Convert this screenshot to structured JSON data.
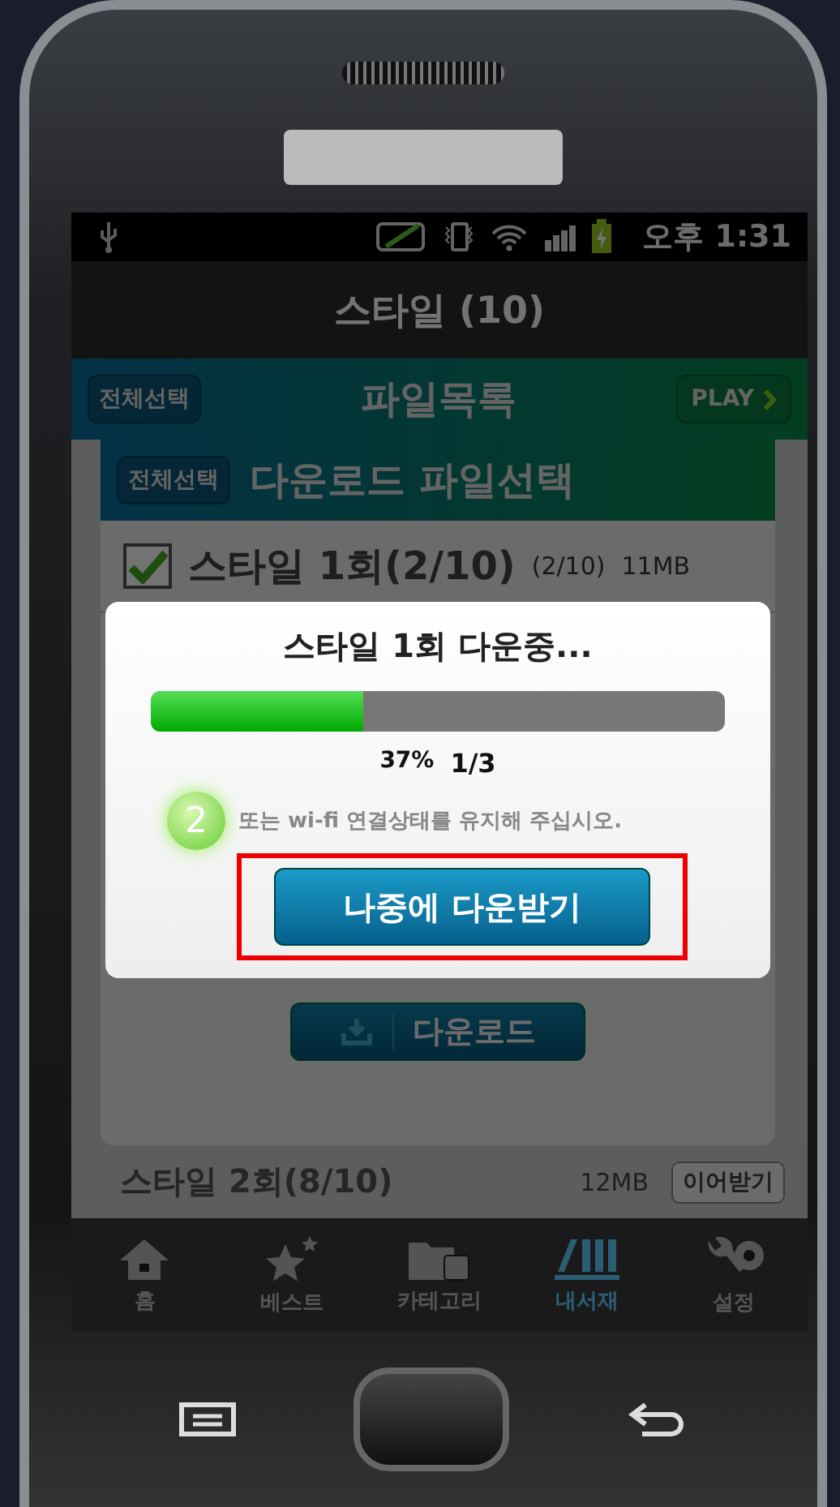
{
  "status_bar": {
    "time": "오후 1:31"
  },
  "title": "스타일 (10)",
  "file_list_header": {
    "select_all": "전체선택",
    "title": "파일목록",
    "play": "PLAY"
  },
  "download_panel": {
    "select_all": "전체선택",
    "title": "다운로드 파일선택",
    "files": [
      {
        "name": "스타일 1회(2/10)",
        "parts": "(2/10)",
        "size": "11MB",
        "checked": true
      }
    ],
    "download_button": "다운로드"
  },
  "list_rows": [
    {
      "name": "스타일 2회(8/10)",
      "size": "12MB",
      "action": "이어받기"
    }
  ],
  "dialog": {
    "title": "스타일 1회 다운중...",
    "level": 0.37,
    "percent": "37%",
    "count": "1/3",
    "notice": "또는 wi-fi 연결상태를 유지해 주십시오.",
    "step_badge": "2",
    "button": "나중에 다운받기",
    "highlighted": true
  },
  "tabs": [
    {
      "label": "홈",
      "kind": "home",
      "selected": false
    },
    {
      "label": "베스트",
      "kind": "best",
      "selected": false
    },
    {
      "label": "카테고리",
      "kind": "category",
      "selected": false
    },
    {
      "label": "내서재",
      "kind": "library",
      "selected": true
    },
    {
      "label": "설정",
      "kind": "settings",
      "selected": false
    }
  ]
}
